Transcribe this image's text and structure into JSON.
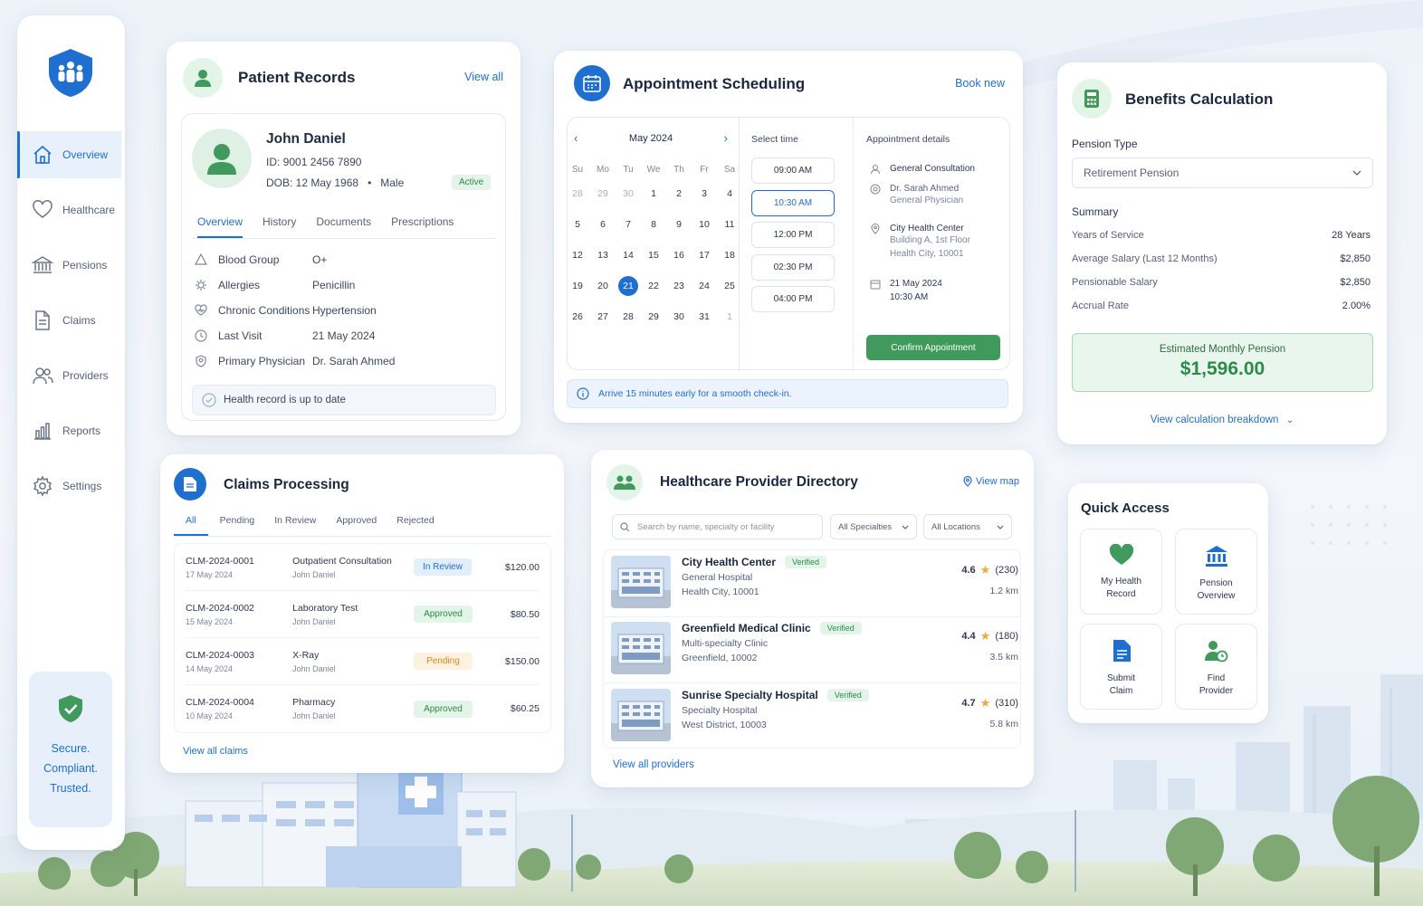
{
  "sidebar": {
    "items": [
      {
        "label": "Overview",
        "icon": "home-icon",
        "active": true
      },
      {
        "label": "Healthcare",
        "icon": "heart-icon"
      },
      {
        "label": "Pensions",
        "icon": "bank-icon"
      },
      {
        "label": "Claims",
        "icon": "document-icon"
      },
      {
        "label": "Providers",
        "icon": "users-icon"
      },
      {
        "label": "Reports",
        "icon": "bar-chart-icon"
      },
      {
        "label": "Settings",
        "icon": "gear-icon"
      }
    ],
    "secure": [
      "Secure.",
      "Compliant.",
      "Trusted."
    ]
  },
  "patient": {
    "title": "Patient Records",
    "view_all": "View all",
    "name": "John Daniel",
    "id": "ID: 9001 2456 7890",
    "dob": "DOB: 12 May 1968",
    "sex": "Male",
    "status": "Active",
    "tabs": [
      "Overview",
      "History",
      "Documents",
      "Prescriptions"
    ],
    "fields": [
      {
        "k": "Blood Group",
        "v": "O+",
        "icon": "drop-icon"
      },
      {
        "k": "Allergies",
        "v": "Penicillin",
        "icon": "allergy-icon"
      },
      {
        "k": "Chronic Conditions",
        "v": "Hypertension",
        "icon": "heart-pulse-icon"
      },
      {
        "k": "Last Visit",
        "v": "21 May 2024",
        "icon": "clock-icon"
      },
      {
        "k": "Primary Physician",
        "v": "Dr. Sarah Ahmed",
        "icon": "physician-icon"
      }
    ],
    "note": "Health record is up to date"
  },
  "appointment": {
    "title": "Appointment Scheduling",
    "book_new": "Book new",
    "month": "May 2024",
    "weekdays": [
      "Su",
      "Mo",
      "Tu",
      "We",
      "Th",
      "Fr",
      "Sa"
    ],
    "days": [
      "28",
      "29",
      "30",
      "1",
      "2",
      "3",
      "4",
      "5",
      "6",
      "7",
      "8",
      "9",
      "10",
      "11",
      "12",
      "13",
      "14",
      "15",
      "16",
      "17",
      "18",
      "19",
      "20",
      "21",
      "22",
      "23",
      "24",
      "25",
      "26",
      "27",
      "28",
      "29",
      "30",
      "31",
      "1"
    ],
    "selected_day": "21",
    "select_time_label": "Select time",
    "slots": [
      "09:00 AM",
      "10:30 AM",
      "12:00 PM",
      "02:30 PM",
      "04:00 PM"
    ],
    "selected_slot": "10:30 AM",
    "details_label": "Appointment details",
    "details": {
      "type": "General Consultation",
      "doctor": "Dr. Sarah Ahmed",
      "doctor_role": "General Physician",
      "facility": "City Health Center",
      "address1": "Building A, 1st Floor",
      "address2": "Health City, 10001",
      "date": "21 May 2024",
      "time": "10:30 AM"
    },
    "confirm": "Confirm Appointment",
    "notice": "Arrive 15 minutes early for a smooth check-in."
  },
  "benefits": {
    "title": "Benefits Calculation",
    "pension_type_label": "Pension Type",
    "pension_type": "Retirement Pension",
    "summary_label": "Summary",
    "rows": [
      {
        "k": "Years of Service",
        "v": "28 Years"
      },
      {
        "k": "Average Salary (Last 12 Months)",
        "v": "$2,850"
      },
      {
        "k": "Pensionable Salary",
        "v": "$2,850"
      },
      {
        "k": "Accrual Rate",
        "v": "2.00%"
      }
    ],
    "estimate_label": "Estimated Monthly Pension",
    "estimate": "$1,596.00",
    "breakdown": "View calculation breakdown"
  },
  "claims": {
    "title": "Claims Processing",
    "tabs": [
      "All",
      "Pending",
      "In Review",
      "Approved",
      "Rejected"
    ],
    "rows": [
      {
        "id": "CLM-2024-0001",
        "date": "17 May 2024",
        "desc": "Outpatient Consultation",
        "who": "John Daniel",
        "status": "In Review",
        "kind": "blue",
        "amount": "$120.00"
      },
      {
        "id": "CLM-2024-0002",
        "date": "15 May 2024",
        "desc": "Laboratory Test",
        "who": "John Daniel",
        "status": "Approved",
        "kind": "green",
        "amount": "$80.50"
      },
      {
        "id": "CLM-2024-0003",
        "date": "14 May 2024",
        "desc": "X-Ray",
        "who": "John Daniel",
        "status": "Pending",
        "kind": "orange",
        "amount": "$150.00"
      },
      {
        "id": "CLM-2024-0004",
        "date": "10 May 2024",
        "desc": "Pharmacy",
        "who": "John Daniel",
        "status": "Approved",
        "kind": "green",
        "amount": "$60.25"
      }
    ],
    "view_all": "View all claims"
  },
  "providers": {
    "title": "Healthcare Provider Directory",
    "view_map": "View map",
    "search_placeholder": "Search by name, specialty or facility",
    "filter_specialties": "All Specialties",
    "filter_locations": "All Locations",
    "items": [
      {
        "name": "City Health Center",
        "type": "General Hospital",
        "addr": "Health City, 10001",
        "badge": "Verified",
        "rating": "4.6",
        "reviews": "(230)",
        "dist": "1.2 km"
      },
      {
        "name": "Greenfield Medical Clinic",
        "type": "Multi-specialty Clinic",
        "addr": "Greenfield, 10002",
        "badge": "Verified",
        "rating": "4.4",
        "reviews": "(180)",
        "dist": "3.5 km"
      },
      {
        "name": "Sunrise Specialty Hospital",
        "type": "Specialty Hospital",
        "addr": "West District, 10003",
        "badge": "Verified",
        "rating": "4.7",
        "reviews": "(310)",
        "dist": "5.8 km"
      }
    ],
    "view_all": "View all providers"
  },
  "quick": {
    "title": "Quick Access",
    "tiles": [
      {
        "l1": "My Health",
        "l2": "Record",
        "icon": "heart-icon"
      },
      {
        "l1": "Pension",
        "l2": "Overview",
        "icon": "bank-icon"
      },
      {
        "l1": "Submit",
        "l2": "Claim",
        "icon": "document-icon"
      },
      {
        "l1": "Find",
        "l2": "Provider",
        "icon": "provider-search-icon"
      }
    ]
  },
  "colors": {
    "primary": "#1f6fd1",
    "green": "#2f8a4a",
    "accent_green": "#3f9a5c"
  }
}
